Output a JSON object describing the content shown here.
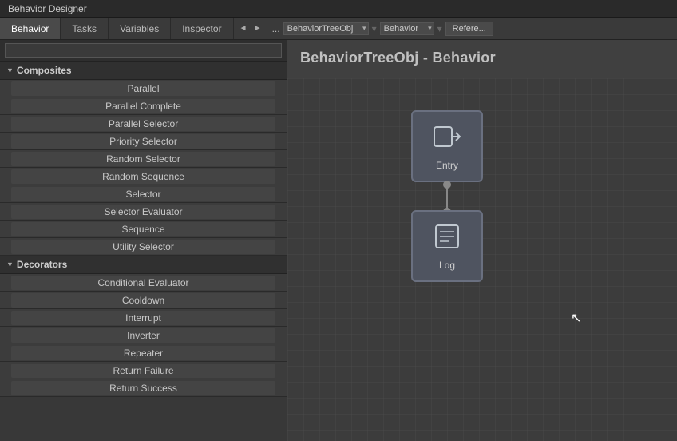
{
  "titleBar": {
    "label": "Behavior Designer"
  },
  "tabs": [
    {
      "id": "behavior",
      "label": "Behavior",
      "active": true
    },
    {
      "id": "tasks",
      "label": "Tasks",
      "active": false
    },
    {
      "id": "variables",
      "label": "Variables",
      "active": false
    },
    {
      "id": "inspector",
      "label": "Inspector",
      "active": false
    }
  ],
  "breadcrumb": {
    "navLeft": "◄",
    "navRight": "►",
    "ellipsis": "...",
    "treeObj": "BehaviorTreeObj",
    "behavior": "Behavior",
    "references": "Refere..."
  },
  "canvasTitle": "BehaviorTreeObj - Behavior",
  "search": {
    "placeholder": ""
  },
  "composites": {
    "label": "Composites",
    "items": [
      "Parallel",
      "Parallel Complete",
      "Parallel Selector",
      "Priority Selector",
      "Random Selector",
      "Random Sequence",
      "Selector",
      "Selector Evaluator",
      "Sequence",
      "Utility Selector"
    ]
  },
  "decorators": {
    "label": "Decorators",
    "items": [
      "Conditional Evaluator",
      "Cooldown",
      "Interrupt",
      "Inverter",
      "Repeater",
      "Return Failure",
      "Return Success"
    ]
  },
  "nodes": {
    "entry": {
      "label": "Entry",
      "icon": "⮕"
    },
    "log": {
      "label": "Log",
      "icon": "📋"
    }
  }
}
